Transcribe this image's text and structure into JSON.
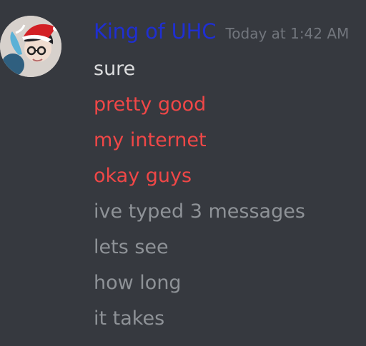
{
  "author": {
    "name": "King of UHC",
    "timestamp": "Today at 1:42 AM",
    "avatar_icon": "user-avatar-santa-hat",
    "name_color": "#1f2fd1"
  },
  "messages": [
    {
      "text": "sure",
      "state": "sent"
    },
    {
      "text": "pretty good",
      "state": "failed"
    },
    {
      "text": "my internet",
      "state": "failed"
    },
    {
      "text": "okay guys",
      "state": "failed"
    },
    {
      "text": "ive typed 3 messages",
      "state": "pending"
    },
    {
      "text": "lets see",
      "state": "pending"
    },
    {
      "text": "how long",
      "state": "pending"
    },
    {
      "text": "it takes",
      "state": "pending"
    }
  ],
  "colors": {
    "background": "#36393f",
    "sent": "#dcddde",
    "failed": "#f04747",
    "pending": "#8e9297",
    "timestamp": "#72767d"
  }
}
